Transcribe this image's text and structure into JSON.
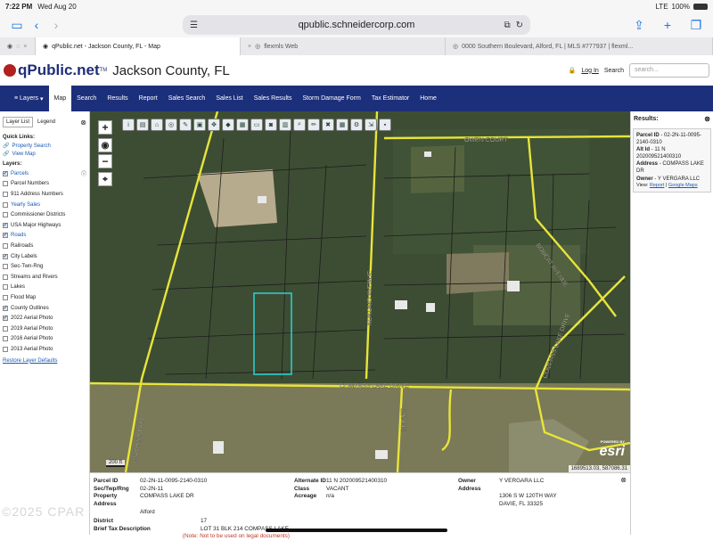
{
  "status_bar": {
    "time": "7:22 PM",
    "date": "Wed Aug 20",
    "network": "LTE",
    "battery": "100%"
  },
  "browser": {
    "url": "qpublic.schneidercorp.com",
    "tabs": [
      {
        "label": "qPublic.net - Jackson County, FL - Map",
        "active": true
      },
      {
        "label": "flexmls Web",
        "active": false
      },
      {
        "label": "0000 Southern Boulevard, Alford, FL | MLS #777937 | flexml...",
        "active": false
      }
    ]
  },
  "header": {
    "logo": "qPublic.net",
    "logo_tm": "TM",
    "county": "Jackson County, FL",
    "login": "Log In",
    "search_label": "Search",
    "search_placeholder": "search..."
  },
  "nav": [
    "Layers",
    "Map",
    "Search",
    "Results",
    "Report",
    "Sales Search",
    "Sales List",
    "Sales Results",
    "Storm Damage Form",
    "Tax Estimator",
    "Home"
  ],
  "left_panel": {
    "tabs": [
      "Layer List",
      "Legend"
    ],
    "quick_links_title": "Quick Links:",
    "quick_links": [
      "Property Search",
      "View Map"
    ],
    "layers_title": "Layers:",
    "layers": [
      {
        "label": "Parcels",
        "checked": true,
        "linked": true
      },
      {
        "label": "Parcel Numbers",
        "checked": false,
        "linked": false
      },
      {
        "label": "911 Address Numbers",
        "checked": false,
        "linked": false
      },
      {
        "label": "Yearly Sales",
        "checked": false,
        "linked": true
      },
      {
        "label": "Commissioner Districts",
        "checked": false,
        "linked": false
      },
      {
        "label": "USA Major Highways",
        "checked": true,
        "linked": false
      },
      {
        "label": "Roads",
        "checked": true,
        "linked": true
      },
      {
        "label": "Railroads",
        "checked": false,
        "linked": false
      },
      {
        "label": "City Labels",
        "checked": true,
        "linked": false
      },
      {
        "label": "Sec-Twn-Rng",
        "checked": false,
        "linked": false
      },
      {
        "label": "Streams and Rivers",
        "checked": false,
        "linked": false
      },
      {
        "label": "Lakes",
        "checked": false,
        "linked": false
      },
      {
        "label": "Flood Map",
        "checked": false,
        "linked": false
      },
      {
        "label": "County Outlines",
        "checked": true,
        "linked": false
      },
      {
        "label": "2022 Aerial Photo",
        "checked": true,
        "linked": false
      },
      {
        "label": "2019 Aerial Photo",
        "checked": false,
        "linked": false
      },
      {
        "label": "2016 Aerial Photo",
        "checked": false,
        "linked": false
      },
      {
        "label": "2013 Aerial Photo",
        "checked": false,
        "linked": false
      }
    ],
    "restore": "Restore Layer Defaults"
  },
  "map": {
    "roads": [
      "OWEN COURT",
      "KOKOMO AVENUE",
      "COMPASS LAKE DRIVE",
      "COMPASS LAKE DRIVE",
      "GATORS ROAD",
      "INN 2ET",
      "BOBCAT AVENUE"
    ],
    "scale": "200 ft",
    "coords": "1689513.03, 587086.31",
    "esri_small": "POWERED BY",
    "esri": "esri"
  },
  "results": {
    "title": "Results:",
    "parcel_id_label": "Parcel ID",
    "parcel_id": "- 02-2N-11-0095-2140-0310",
    "alt_id_label": "Alt Id",
    "alt_id": "- 11 N 202009521400310",
    "address_label": "Address",
    "address": "- COMPASS LAKE DR",
    "owner_label": "Owner",
    "owner": "- Y VERGARA LLC",
    "view_label": "View:",
    "link_report": "Report",
    "link_maps": "Google Maps"
  },
  "details": {
    "parcel_id_label": "Parcel ID",
    "parcel_id": "02-2N-11-0095-2140-0310",
    "str_label": "Sec/Twp/Rng",
    "str": "02-2N-11",
    "addr_label": "Property Address",
    "addr1": "COMPASS LAKE DR",
    "addr2": "Alford",
    "district_label": "District",
    "district": "17",
    "brief_label": "Brief Tax Description",
    "brief": "LOT 31 BLK 214 COMPASS LAKE",
    "note": "(Note: Not to be used on legal documents)",
    "alt_label": "Alternate ID",
    "alt": "11 N 202009521400310",
    "class_label": "Class",
    "class": "VACANT",
    "acreage_label": "Acreage",
    "acreage": "n/a",
    "owner_label": "Owner Address",
    "owner1": "Y VERGARA LLC",
    "owner2": "1306 S W 120TH WAY",
    "owner3": "DAVIE, FL 33325"
  },
  "watermark": "©2025 CPAR"
}
